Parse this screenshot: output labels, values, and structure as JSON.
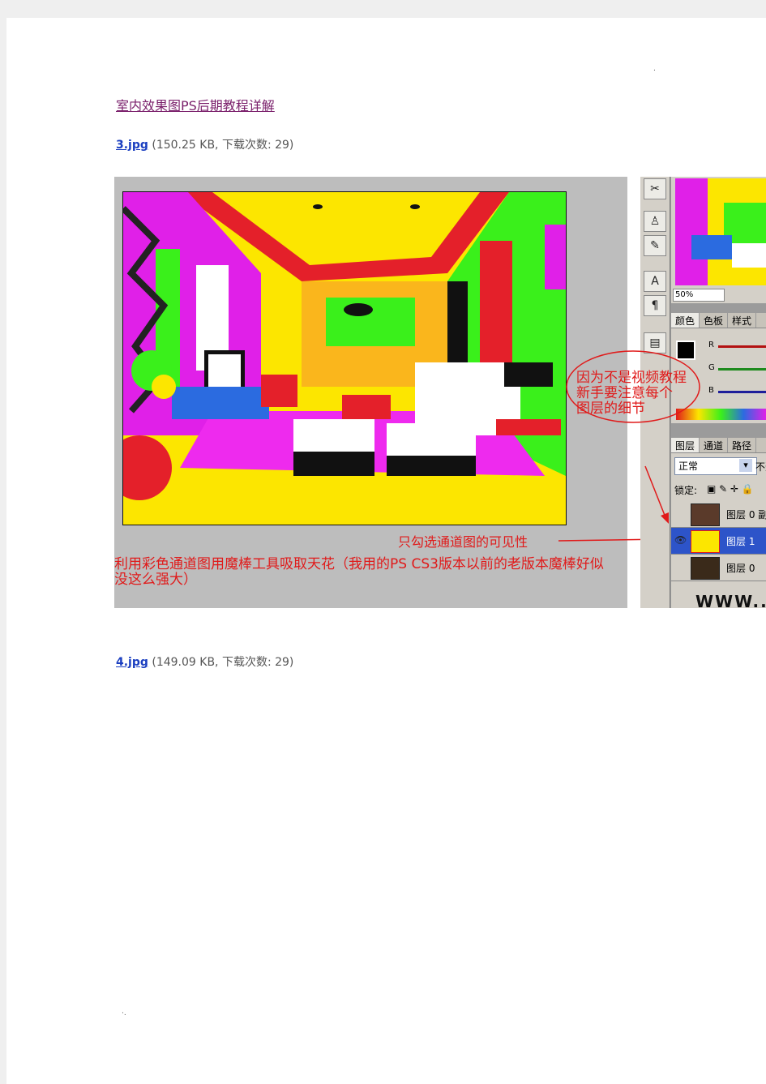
{
  "header": {
    "title": "室内效果图PS后期教程详解"
  },
  "attachments": [
    {
      "filename": "3.jpg",
      "meta": "(150.25 KB, 下载次数: 29)"
    },
    {
      "filename": "4.jpg",
      "meta": "(149.09 KB, 下载次数: 29)"
    }
  ],
  "screenshot": {
    "annotations": {
      "note_top": "因为不是视频教程",
      "note_mid": "新手要注意每个",
      "note_bot": "图层的细节",
      "visible_label": "只勾选通道图的可见性",
      "magic_wand_line1": "利用彩色通道图用魔棒工具吸取天花（我用的PS CS3版本以前的老版本魔棒好似",
      "magic_wand_line2": "没这么强大）"
    },
    "photoshop": {
      "zoom": "50%",
      "color_tabs": [
        "颜色",
        "色板",
        "样式"
      ],
      "channels": [
        "R",
        "G",
        "B"
      ],
      "layer_tabs": [
        "图层",
        "通道",
        "路径"
      ],
      "blend_mode": "正常",
      "opacity_label": "不透",
      "lock_label": "锁定:",
      "layers": [
        "图层 0 副",
        "图层 1",
        "图层 0"
      ],
      "watermark": "WWW.."
    },
    "colors": {
      "accent_red": "#e01a1a",
      "selected_layer": "#2d54c9"
    }
  }
}
